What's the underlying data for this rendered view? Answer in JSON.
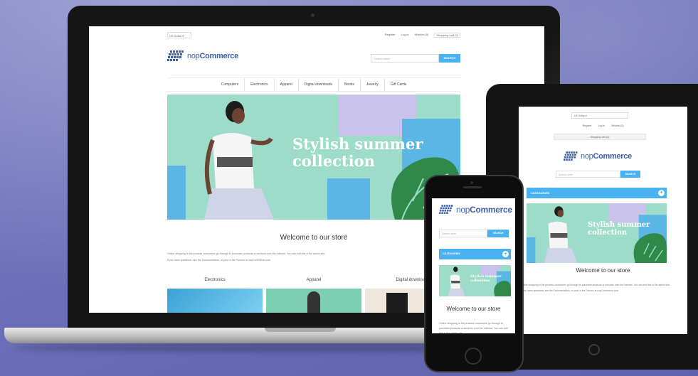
{
  "brand": {
    "logo_prefix": "nop",
    "logo_name": "Commerce",
    "accent_color": "#4ab2f1",
    "background_color": "#6c70b8"
  },
  "laptop": {
    "currency": "US Dollar",
    "top_links": [
      "Register",
      "Log in",
      "Wishlist (0)"
    ],
    "cart": "Shopping cart (0)",
    "search_placeholder": "Search store",
    "search_button": "SEARCH",
    "nav": [
      "Computers",
      "Electronics",
      "Apparel",
      "Digital downloads",
      "Books",
      "Jewelry",
      "Gift Cards"
    ],
    "banner_title_line1": "Stylish summer",
    "banner_title_line2": "collection",
    "welcome": "Welcome to our store",
    "paragraph_1": "Online shopping is the process consumers go through to purchase products or services over the Internet. You can edit this in the admin site.",
    "paragraph_2": "If you have questions, see the Documentation, or post in the Forums at nopCommerce.com",
    "categories": [
      "Electronics",
      "Apparel",
      "Digital downloads"
    ]
  },
  "tablet": {
    "currency": "US Dollar",
    "top_links": [
      "Register",
      "Log in",
      "Wishlist (0)"
    ],
    "cart": "Shopping cart (0)",
    "search_placeholder": "Search store",
    "search_button": "SEARCH",
    "categories_bar": "CATEGORIES",
    "banner_title_line1": "Stylish summer",
    "banner_title_line2": "collection",
    "welcome": "Welcome to our store",
    "paragraph_1": "Online shopping is the process consumers go through to purchase products or services over the Internet. You can edit this in the admin site.",
    "paragraph_2": "If you have questions, see the Documentation, or post in the Forums at nopCommerce.com"
  },
  "phone": {
    "search_placeholder": "Search store",
    "search_button": "SEARCH",
    "categories_bar": "CATEGORIES",
    "banner_title_line1": "Stylish summer",
    "banner_title_line2": "collection",
    "welcome": "Welcome to our store",
    "paragraph": "Online shopping is the process consumers go through to purchase products or services over the Internet. You can edit this in the admin site."
  }
}
